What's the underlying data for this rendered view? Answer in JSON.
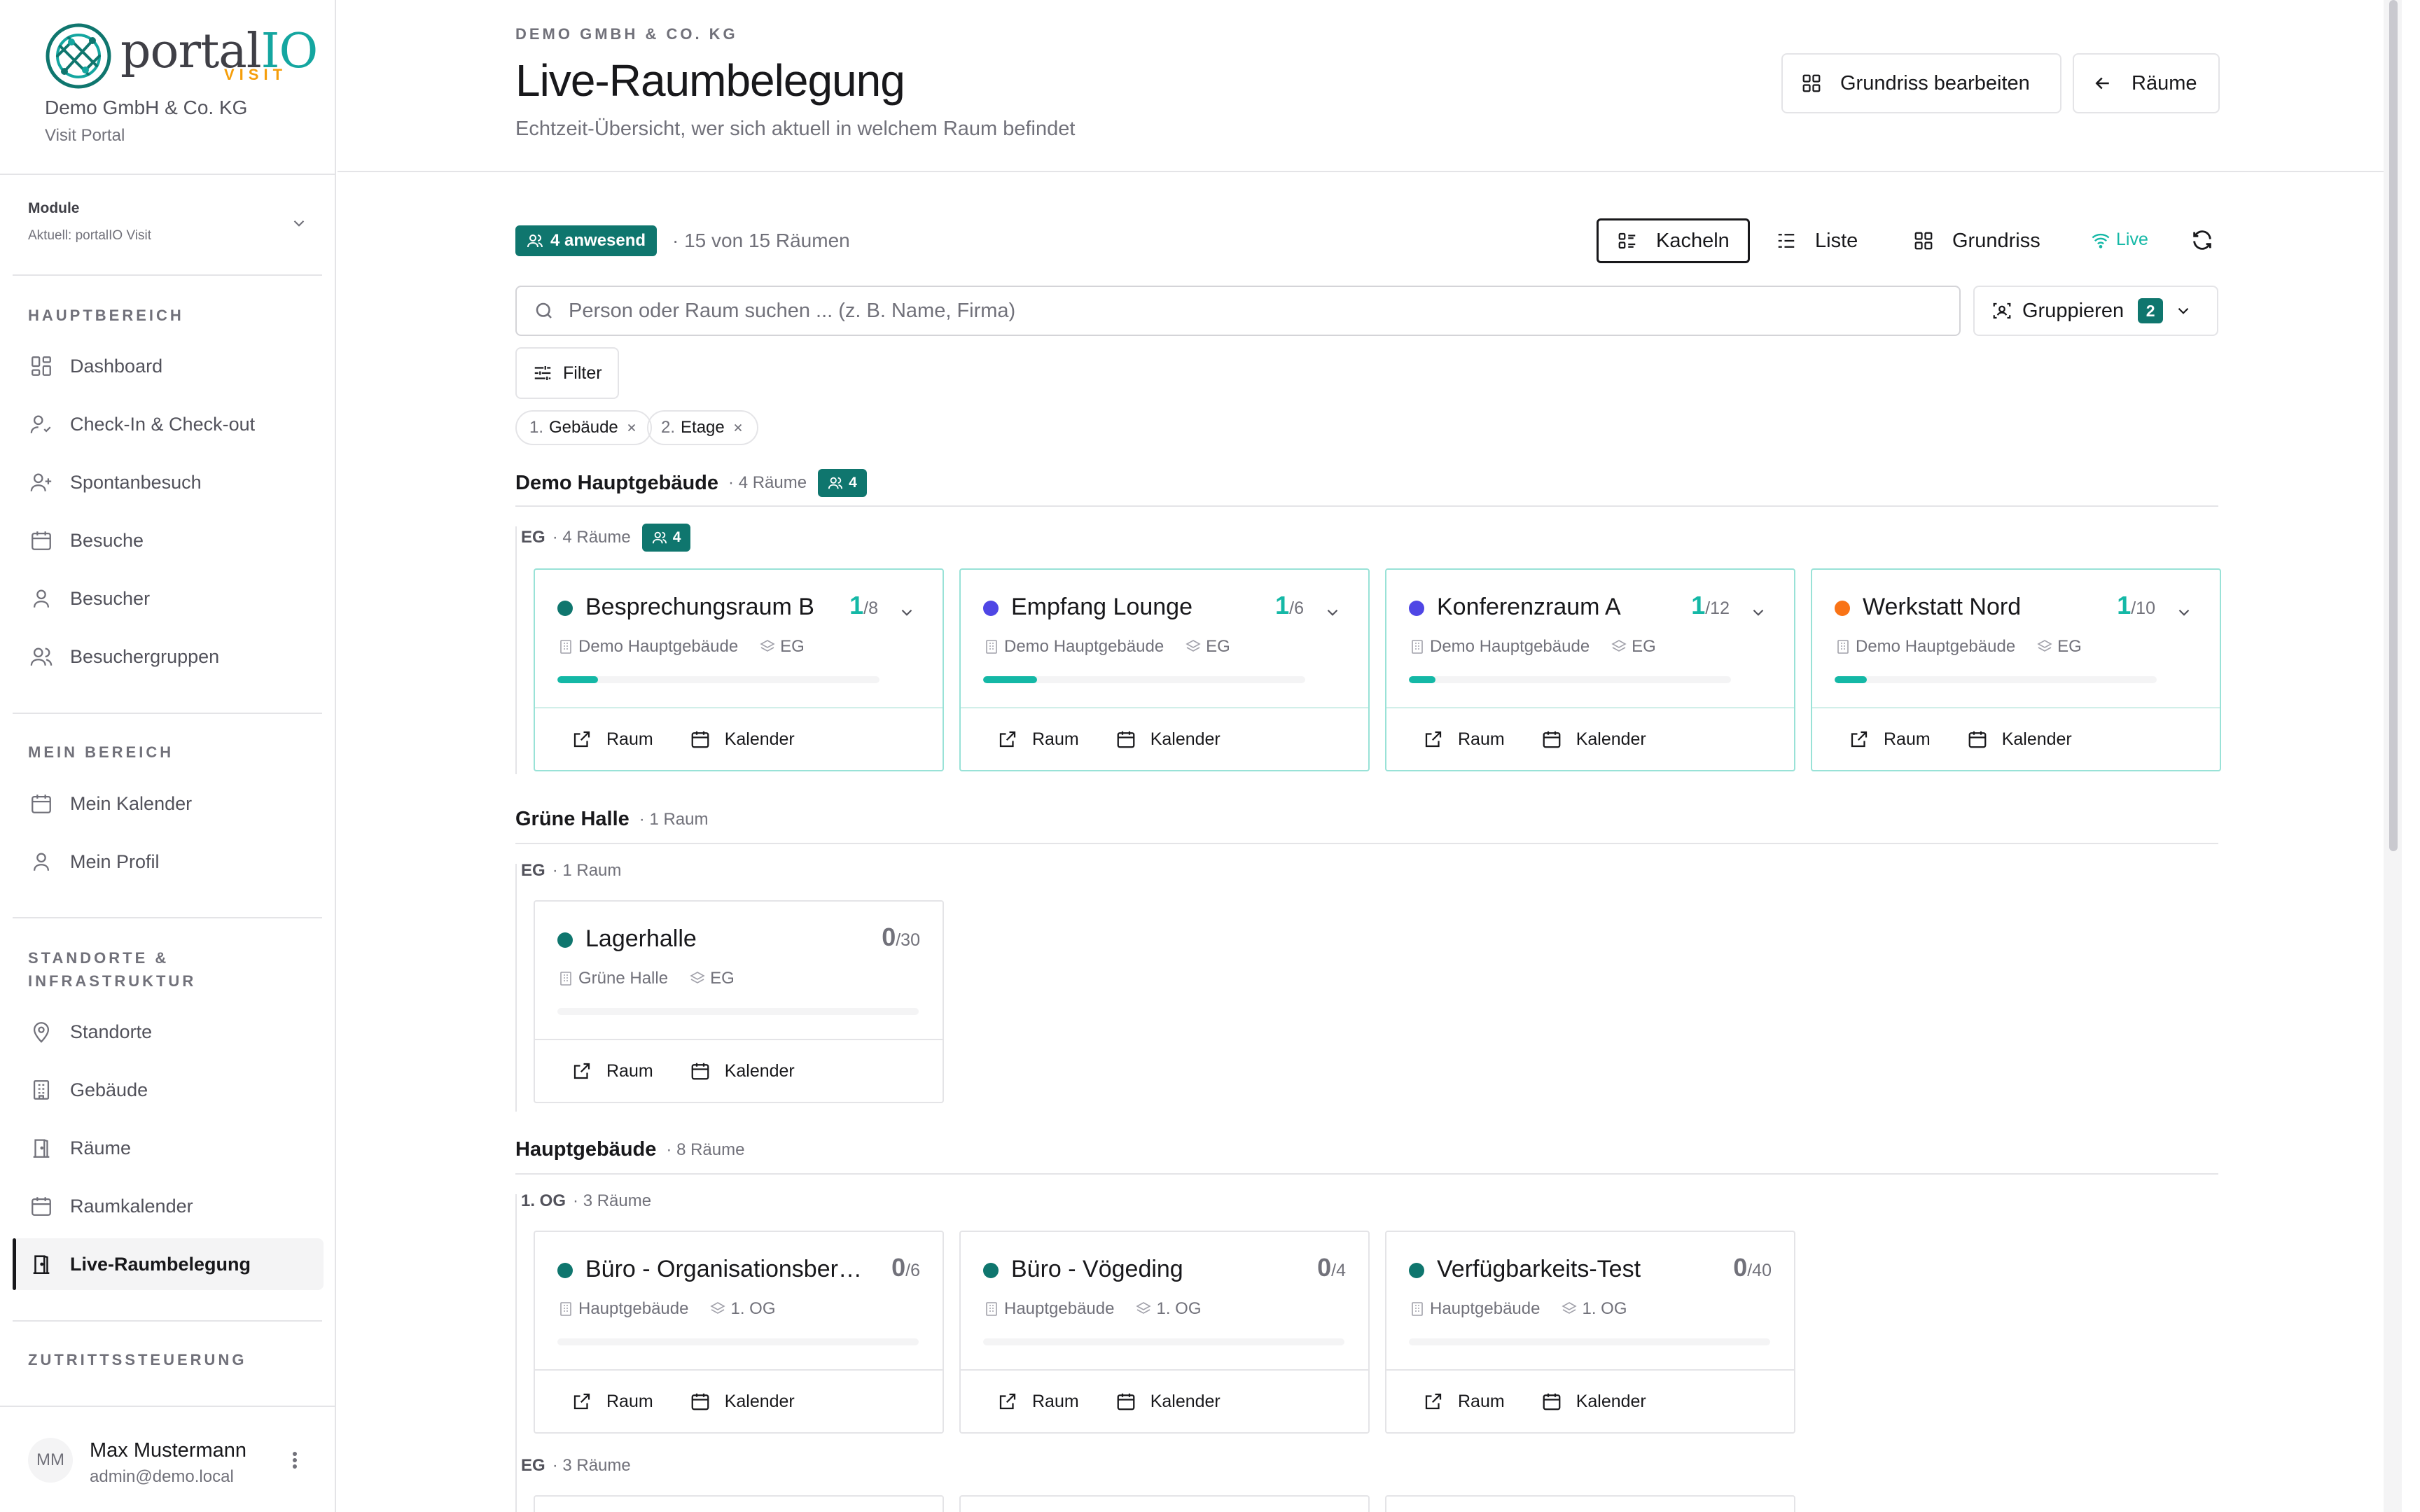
{
  "brand": {
    "word_main": "portal",
    "word_accent": "IO",
    "sub": "VISIT",
    "accent_color": "#14a6a0",
    "sub_color": "#f59e0b"
  },
  "org": {
    "name": "Demo GmbH & Co. KG",
    "portal": "Visit Portal"
  },
  "module": {
    "title": "Module",
    "current": "Aktuell: portalIO Visit"
  },
  "sidebar": {
    "sections": [
      {
        "label": "HAUPTBEREICH",
        "items": [
          {
            "label": "Dashboard",
            "icon": "dashboard-icon"
          },
          {
            "label": "Check-In & Check-out",
            "icon": "user-check-icon"
          },
          {
            "label": "Spontanbesuch",
            "icon": "user-plus-icon"
          },
          {
            "label": "Besuche",
            "icon": "calendar-icon"
          },
          {
            "label": "Besucher",
            "icon": "user-icon"
          },
          {
            "label": "Besuchergruppen",
            "icon": "users-icon"
          }
        ]
      },
      {
        "label": "MEIN BEREICH",
        "items": [
          {
            "label": "Mein Kalender",
            "icon": "calendar-icon"
          },
          {
            "label": "Mein Profil",
            "icon": "user-icon"
          }
        ]
      },
      {
        "label_line1": "STANDORTE &",
        "label_line2": "INFRASTRUKTUR",
        "items": [
          {
            "label": "Standorte",
            "icon": "map-pin-icon"
          },
          {
            "label": "Gebäude",
            "icon": "building-icon"
          },
          {
            "label": "Räume",
            "icon": "door-icon"
          },
          {
            "label": "Raumkalender",
            "icon": "calendar-icon"
          },
          {
            "label": "Live-Raumbelegung",
            "icon": "door-icon",
            "active": true
          }
        ]
      },
      {
        "label": "ZUTRITTSSTEUERUNG",
        "items": []
      }
    ]
  },
  "user": {
    "initials": "MM",
    "name": "Max Mustermann",
    "email": "admin@demo.local"
  },
  "header": {
    "eyebrow": "DEMO GMBH & CO. KG",
    "title": "Live-Raumbelegung",
    "subtitle": "Echtzeit-Übersicht, wer sich aktuell in welchem Raum befindet",
    "edit_floorplan_label": "Grundriss bearbeiten",
    "rooms_label": "Räume"
  },
  "toolbar": {
    "present_badge": "4 anwesend",
    "room_count": "15 von 15 Räumen",
    "views": [
      "Kacheln",
      "Liste",
      "Grundriss"
    ],
    "active_view": "Kacheln",
    "live_label": "Live",
    "search_placeholder": "Person oder Raum suchen ... (z. B. Name, Firma)",
    "search_value": "",
    "group_label": "Gruppieren",
    "group_count": "2",
    "filter_label": "Filter",
    "chips": [
      {
        "num": "1.",
        "label": "Gebäude"
      },
      {
        "num": "2.",
        "label": "Etage"
      }
    ]
  },
  "colors": {
    "teal": "#14b8a6",
    "teal_dark": "#0f766e",
    "green_dot": "#0f766e",
    "violet_dot": "#4f46e5",
    "orange_dot": "#f97316"
  },
  "groups": [
    {
      "title": "Demo Hauptgebäude",
      "meta": "· 4 Räume",
      "present": "4",
      "floors": [
        {
          "title": "EG",
          "meta": "· 4 Räume",
          "present": "4",
          "rooms": [
            {
              "name": "Besprechungsraum B",
              "occupied": "1",
              "capacity": "/8",
              "building": "Demo Hauptgebäude",
              "floor": "EG",
              "dot": "#0f766e",
              "fill": 0.125
            },
            {
              "name": "Empfang Lounge",
              "occupied": "1",
              "capacity": "/6",
              "building": "Demo Hauptgebäude",
              "floor": "EG",
              "dot": "#4f46e5",
              "fill": 0.1667
            },
            {
              "name": "Konferenzraum A",
              "occupied": "1",
              "capacity": "/12",
              "building": "Demo Hauptgebäude",
              "floor": "EG",
              "dot": "#4f46e5",
              "fill": 0.0833
            },
            {
              "name": "Werkstatt Nord",
              "occupied": "1",
              "capacity": "/10",
              "building": "Demo Hauptgebäude",
              "floor": "EG",
              "dot": "#f97316",
              "fill": 0.1
            }
          ]
        }
      ]
    },
    {
      "title": "Grüne Halle",
      "meta": "· 1 Raum",
      "floors": [
        {
          "title": "EG",
          "meta": "· 1 Raum",
          "rooms": [
            {
              "name": "Lagerhalle",
              "occupied": "0",
              "capacity": "/30",
              "building": "Grüne Halle",
              "floor": "EG",
              "dot": "#0f766e",
              "fill": 0
            }
          ]
        }
      ]
    },
    {
      "title": "Hauptgebäude",
      "meta": "· 8 Räume",
      "floors": [
        {
          "title": "1. OG",
          "meta": "· 3 Räume",
          "rooms": [
            {
              "name": "Büro - Organisationsbereich",
              "occupied": "0",
              "capacity": "/6",
              "building": "Hauptgebäude",
              "floor": "1. OG",
              "dot": "#0f766e",
              "fill": 0
            },
            {
              "name": "Büro - Vögeding",
              "occupied": "0",
              "capacity": "/4",
              "building": "Hauptgebäude",
              "floor": "1. OG",
              "dot": "#0f766e",
              "fill": 0
            },
            {
              "name": "Verfügbarkeits-Test",
              "occupied": "0",
              "capacity": "/40",
              "building": "Hauptgebäude",
              "floor": "1. OG",
              "dot": "#0f766e",
              "fill": 0
            }
          ]
        },
        {
          "title": "EG",
          "meta": "· 3 Räume",
          "rooms": []
        }
      ]
    }
  ],
  "card_actions": {
    "room": "Raum",
    "calendar": "Kalender"
  }
}
